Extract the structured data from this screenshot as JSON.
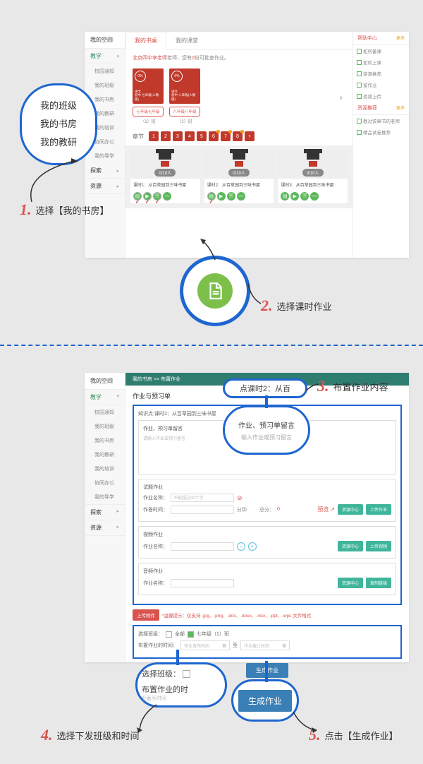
{
  "sidebar": {
    "space": "我的空间",
    "teach": "教学",
    "items": [
      "校园通知",
      "我的班级",
      "我的书房",
      "我的教研",
      "我的培训",
      "协同办公",
      "我的导学"
    ],
    "explore": "探索",
    "resource": "资源"
  },
  "tabs": {
    "bookshelf": "我的书桌",
    "classroom": "我的课堂"
  },
  "notice": {
    "pre": "北京四中李老师",
    "mid": "老师，您有",
    "num": "0",
    "suf": "份可批查作业。"
  },
  "books": [
    {
      "pct": "0%",
      "subj": "语文",
      "grade": "初中 七年级(人教版)",
      "label": "七年级七年级",
      "cls": "（1）班"
    },
    {
      "pct": "0%",
      "subj": "语文",
      "grade": "初中 八年级(人教版)",
      "label": "八年级八年级",
      "cls": "（2）班"
    }
  ],
  "chapters": {
    "label": "章节",
    "nums": [
      "1",
      "2",
      "3",
      "4",
      "5",
      "6",
      "7",
      "8",
      "+"
    ]
  },
  "lessons": [
    {
      "count": "0/10人",
      "title": "课时1：从百草园到三味书屋"
    },
    {
      "count": "0/10人",
      "title": "课时2：从百草园到三味书屋"
    },
    {
      "count": "0/10人",
      "title": "课时3：从百草园到三味书屋"
    }
  ],
  "right": {
    "help": "帮助中心",
    "more": "更多",
    "helpItems": [
      "如何备课",
      "如何上课",
      "资源推荐",
      "留作业",
      "资源上传"
    ],
    "rec": "资源推荐",
    "recItems": [
      "教过该章节的老师",
      "精品试卷推荐"
    ]
  },
  "bubble1": [
    "我的班级",
    "我的书房",
    "我的教研"
  ],
  "steps": {
    "s1": "选择【我的书房】",
    "s2": "选择课时作业",
    "s3": "布置作业内容",
    "s4": "选择下发班级和时间",
    "s5": "点击【生成作业】"
  },
  "app2": {
    "crumb": "我的书房 >> 布置作业",
    "title": "作业与预习单",
    "knowledge": "知识点:课时2：从百草园到三味书屋",
    "msgTitle": "作业、预习单留言",
    "msgPh": "请输入作业或预习留言",
    "test": {
      "t": "试题作业",
      "nameL": "作业名称：",
      "nameVal": "不能超过30个字",
      "timeL": "作答时间：",
      "mins": "分钟",
      "scoreL": "总分：",
      "score": "0",
      "prev": "预览",
      "rc": "资源中心",
      "up": "上传作业"
    },
    "video": {
      "t": "视频作业",
      "nameL": "作业名称：",
      "rc": "资源中心",
      "up": "上传视频"
    },
    "audio": {
      "t": "音频作业",
      "nameL": "作业名称：",
      "rc": "资源中心",
      "up": "复制链接"
    },
    "upload": {
      "btn": "上传附件",
      "hint": "*温馨提示：仅支持 .jpg、.png、.doc、.docx、.xlsx、.ppt、.wps 文件格式"
    },
    "sel": {
      "clsL": "选择班级：",
      "all": "全部",
      "g7": "七年级（1）班",
      "timeL": "布置作业的时间：",
      "ph1": "作业发布时间",
      "to": "至",
      "ph2": "作业截止时间"
    },
    "gen": "生成作业"
  },
  "callouts": {
    "kt": "点课时2：从百",
    "hw": "作业、预习单留言",
    "hwPh": "输入作业或预习留言",
    "selCls": "选择班级：",
    "selTime": "布置作业的时",
    "selTimePh": "业截至时间",
    "gen": "生成作业"
  }
}
